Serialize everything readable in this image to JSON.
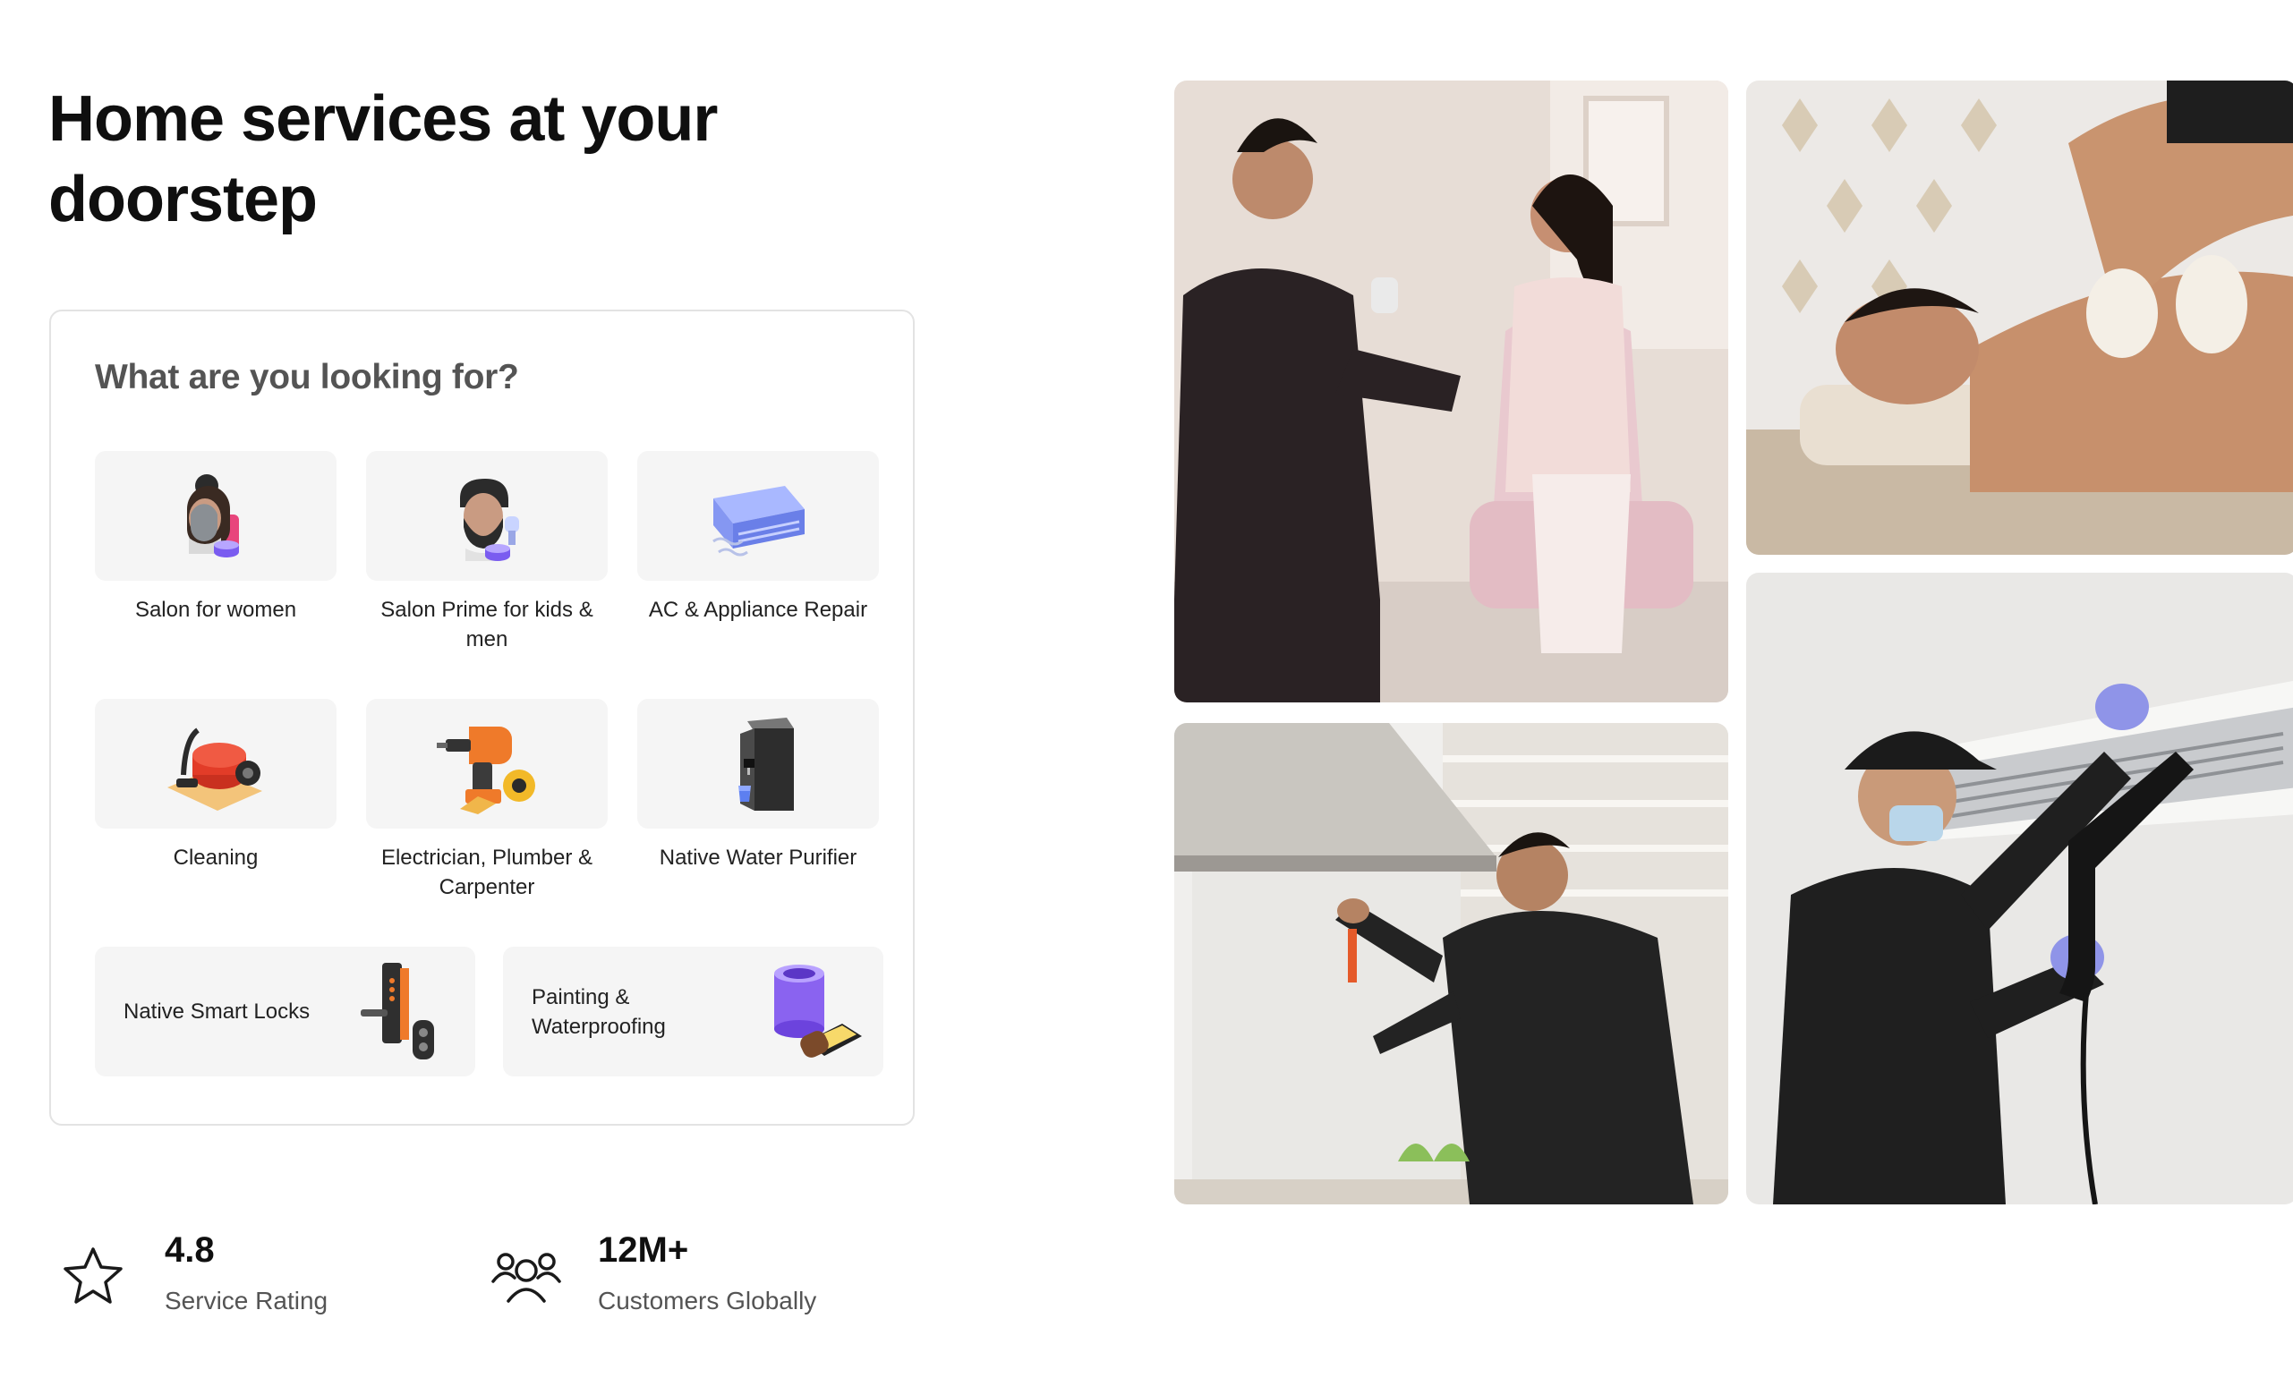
{
  "hero": {
    "title": "Home services at your doorstep"
  },
  "finder": {
    "title": "What are you looking for?",
    "categories": [
      {
        "label": "Salon for women",
        "icon": "salon-women-icon"
      },
      {
        "label": "Salon Prime for kids & men",
        "icon": "salon-men-icon"
      },
      {
        "label": "AC & Appliance Repair",
        "icon": "ac-unit-icon"
      },
      {
        "label": "Cleaning",
        "icon": "vacuum-cleaner-icon"
      },
      {
        "label": "Electrician, Plumber & Carpenter",
        "icon": "drill-tools-icon"
      },
      {
        "label": "Native Water Purifier",
        "icon": "water-purifier-icon"
      }
    ],
    "wide_categories": [
      {
        "label": "Native Smart Locks",
        "icon": "smart-lock-icon"
      },
      {
        "label": "Painting & Waterproofing",
        "icon": "paint-bucket-icon"
      }
    ]
  },
  "stats": [
    {
      "value": "4.8",
      "label": "Service Rating",
      "icon": "star-icon"
    },
    {
      "value": "12M+",
      "label": "Customers Globally",
      "icon": "users-group-icon"
    }
  ],
  "photos": [
    {
      "subject": "salon-at-home-photo"
    },
    {
      "subject": "massage-photo"
    },
    {
      "subject": "chimney-repair-photo"
    },
    {
      "subject": "ac-cleaning-photo"
    }
  ],
  "colors": {
    "accent": "#6e42e5",
    "text": "#0f0f0f",
    "muted": "#545454",
    "tile": "#f5f5f5"
  }
}
